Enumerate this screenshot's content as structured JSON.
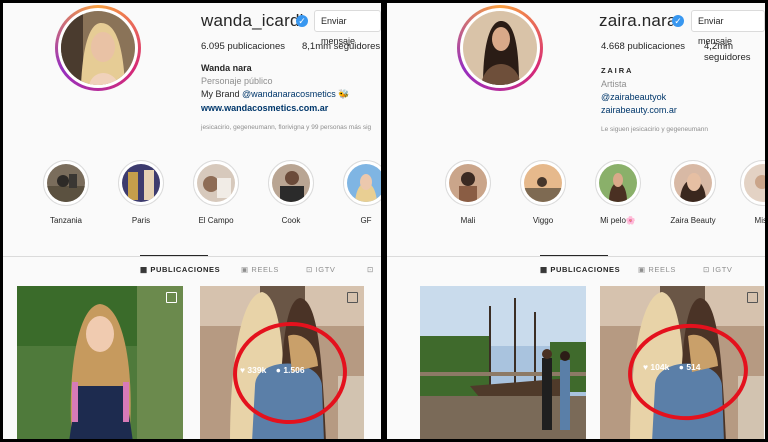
{
  "left": {
    "username": "wanda_icardi",
    "message_button": "Enviar mensaje",
    "posts": "6.095 publicaciones",
    "followers": "8,1mm seguidores",
    "name": "Wanda nara",
    "category": "Personaje público",
    "bio_prefix": "My Brand ",
    "bio_mention": "@wandanaracosmetics",
    "bio_emoji": "🐝",
    "website": "www.wandacosmetics.com.ar",
    "followed_by": "jesicacirio, gegeneumann, florivigna y 99 personas más sig",
    "highlights": [
      "Tanzania",
      "Paris",
      "El Campo",
      "Cook",
      "GF"
    ],
    "tabs": [
      "PUBLICACIONES",
      "REELS",
      "IGTV"
    ],
    "post2_likes": "339k",
    "post2_comments": "1.506"
  },
  "right": {
    "username": "zaira.nara",
    "message_button": "Enviar mensaje",
    "posts": "4.668 publicaciones",
    "followers": "4,2mm seguidores",
    "name": "Z A I R A",
    "category": "Artista",
    "bio_mention": "@zairabeautyok",
    "website": "zairabeauty.com.ar",
    "followed_by": "Le siguen jesicacirio y gegeneumann",
    "highlights": [
      "Mali",
      "Viggo",
      "Mi pelo",
      "Zaira Beauty",
      "Mis t"
    ],
    "highlight_emoji": "🌸",
    "tabs": [
      "PUBLICACIONES",
      "REELS",
      "IGTV"
    ],
    "post2_likes": "104k",
    "post2_comments": "514"
  },
  "colors": {
    "accent_red": "#e4111d",
    "link_blue": "#00376b",
    "verified_blue": "#3897f0"
  },
  "icons": [
    "verified-icon",
    "grid-icon",
    "reels-icon",
    "igtv-icon",
    "heart-icon",
    "comment-icon",
    "multi-post-icon"
  ]
}
